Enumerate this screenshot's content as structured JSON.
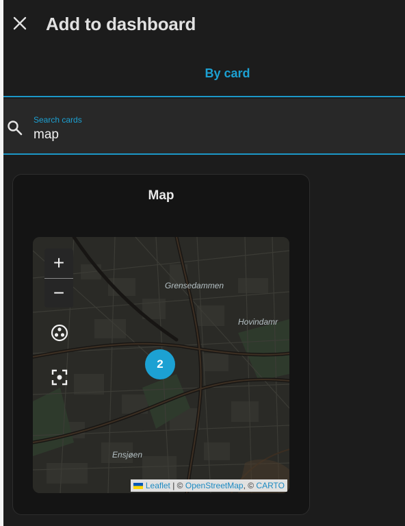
{
  "header": {
    "title": "Add to dashboard",
    "close_icon": "close-icon"
  },
  "tabs": [
    {
      "label": "By card",
      "active": true
    }
  ],
  "search": {
    "label": "Search cards",
    "value": "map",
    "icon": "search-icon"
  },
  "card": {
    "title": "Map",
    "map": {
      "zoom_in_label": "+",
      "zoom_out_label": "−",
      "places": [
        "Grensedammen",
        "Hovindamr",
        "Ensjøen"
      ],
      "cluster_count": "2",
      "attribution": {
        "leaflet": "Leaflet",
        "sep1": " | © ",
        "osm": "OpenStreetMap",
        "sep2": ", © ",
        "carto": "CARTO"
      }
    }
  },
  "colors": {
    "accent": "#1ca1d3",
    "background": "#1c1c1c",
    "card": "#141414"
  }
}
